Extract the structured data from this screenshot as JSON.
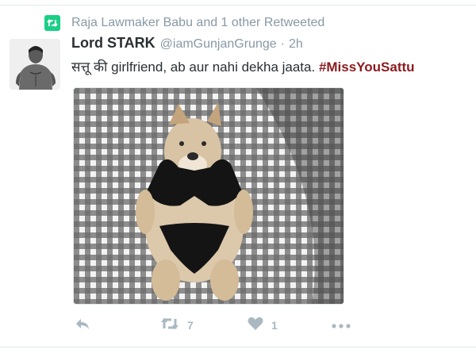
{
  "retweet_context": {
    "text": "Raja Lawmaker Babu and 1 other Retweeted",
    "icon": "retweet-icon",
    "color": "#19cf86"
  },
  "tweet": {
    "display_name": "Lord STARK",
    "handle": "@iamGunjanGrunge",
    "separator": "·",
    "time": "2h",
    "text": "सत्तू की girlfriend, ab aur nahi dekha jaata.",
    "hashtag": "#MissYouSattu",
    "hashtag_color": "#8b1b1e"
  },
  "actions": {
    "reply_icon": "reply-icon",
    "retweet_icon": "retweet-icon",
    "retweet_count": "7",
    "like_icon": "heart-icon",
    "like_count": "1",
    "more_icon": "more-icon"
  },
  "colors": {
    "muted": "#8899a6",
    "action": "#aab8c2",
    "text": "#292f33"
  }
}
